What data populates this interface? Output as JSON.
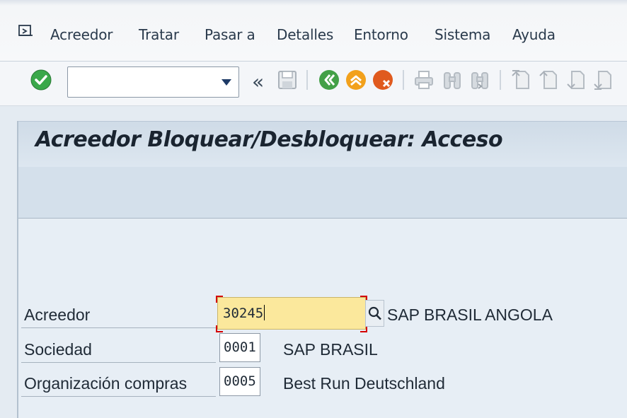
{
  "menu": {
    "items": [
      {
        "label": "Acreedor"
      },
      {
        "label": "Tratar"
      },
      {
        "label": "Pasar a"
      },
      {
        "label": "Detalles"
      },
      {
        "label": "Entorno"
      },
      {
        "label": "Sistema"
      },
      {
        "label": "Ayuda"
      }
    ]
  },
  "toolbar": {
    "command_field_value": "",
    "icons": [
      "enter-check-icon",
      "command-dropdown-icon",
      "collapse-double-arrow-icon",
      "save-icon",
      "back-icon",
      "exit-icon",
      "cancel-icon",
      "print-icon",
      "find-icon",
      "find-next-icon",
      "first-page-icon",
      "previous-page-icon",
      "next-page-icon",
      "last-page-icon"
    ]
  },
  "title": "Acreedor Bloquear/Desbloquear: Acceso",
  "form": {
    "acreedor": {
      "label": "Acreedor",
      "value": "30245",
      "description": "SAP BRASIL ANGOLA"
    },
    "sociedad": {
      "label": "Sociedad",
      "value": "0001",
      "description": "SAP BRASIL"
    },
    "org_compras": {
      "label": "Organización compras",
      "value": "0005",
      "description": "Best Run Deutschland"
    }
  },
  "colors": {
    "active_field": "#fbe89c",
    "required_marker": "#d40000",
    "enter_button": "#3aa84a",
    "back_button": "#3f9b3f",
    "exit_button": "#f2a11c",
    "cancel_button": "#e05a1e"
  }
}
